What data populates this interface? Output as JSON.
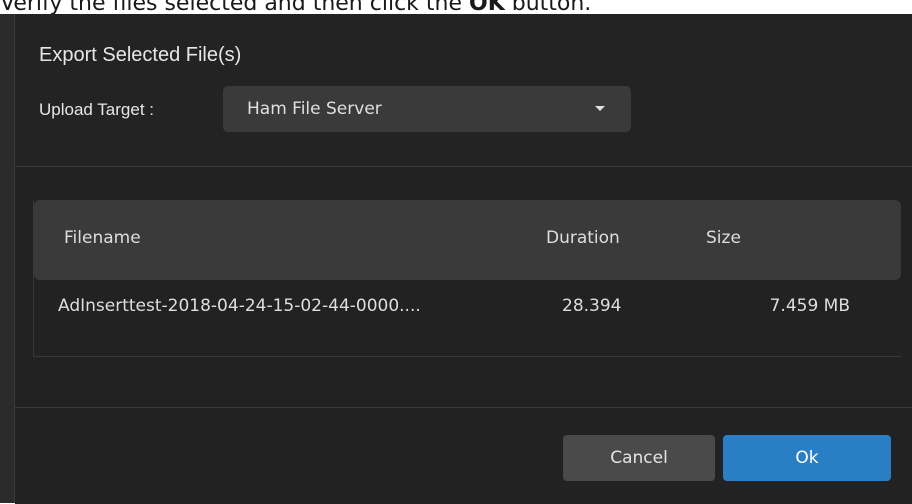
{
  "instruction": {
    "text_before": "Verify the files selected and then click the ",
    "bold": "OK",
    "text_after": " button."
  },
  "dialog": {
    "title": "Export Selected File(s)",
    "upload_target_label": "Upload Target :",
    "upload_target_value": "Ham File Server"
  },
  "table": {
    "headers": {
      "filename": "Filename",
      "duration": "Duration",
      "size": "Size"
    },
    "rows": [
      {
        "filename": "AdInserttest-2018-04-24-15-02-44-0000....",
        "duration": "28.394",
        "size": "7.459 MB"
      }
    ]
  },
  "footer": {
    "cancel_label": "Cancel",
    "ok_label": "Ok"
  },
  "colors": {
    "primary_button": "#2a7ec4",
    "dialog_bg": "#222222"
  }
}
